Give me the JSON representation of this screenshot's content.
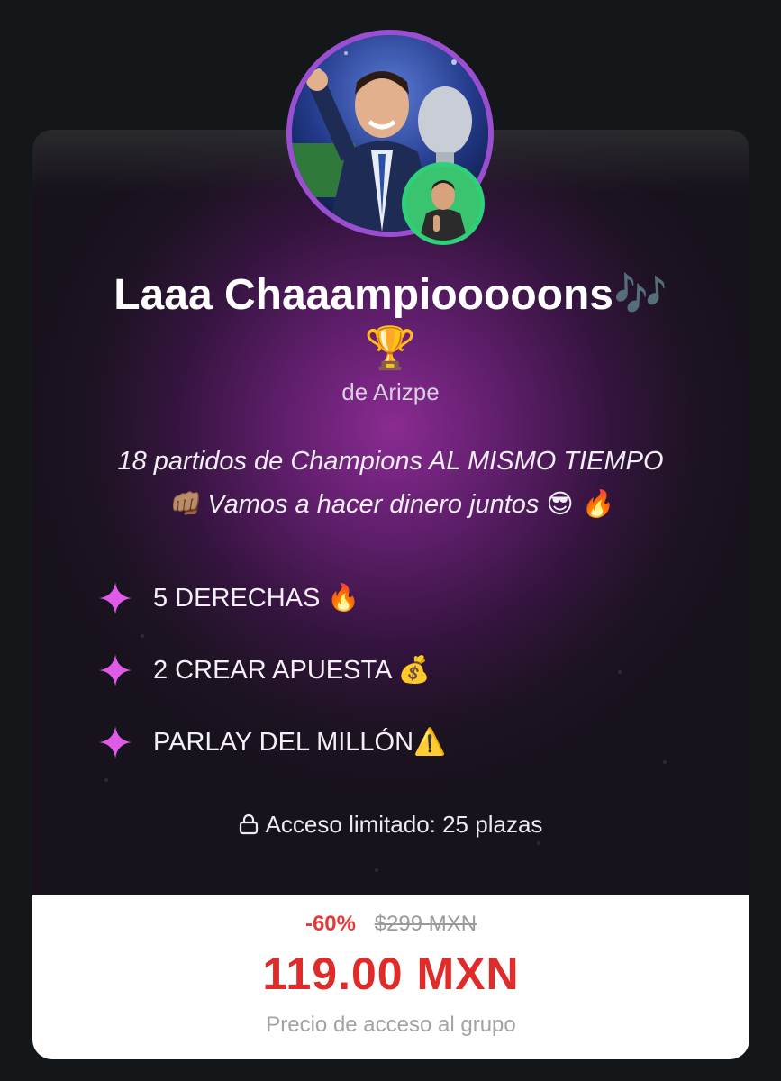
{
  "group": {
    "title": "Laaa Chaaampiooooons",
    "title_emoji": "🎶",
    "trophy_emoji": "🏆",
    "author": "de Arizpe",
    "description_line1": "18 partidos de Champions AL MISMO TIEMPO",
    "description_line2": "👊🏽 Vamos a hacer dinero juntos 😎 🔥"
  },
  "features": [
    {
      "label": "5 DERECHAS 🔥"
    },
    {
      "label": "2 CREAR APUESTA 💰"
    },
    {
      "label": "PARLAY DEL MILLÓN⚠️"
    }
  ],
  "access": {
    "text": "Acceso limitado: 25 plazas",
    "icon": "lock-icon"
  },
  "pricing": {
    "discount": "-60%",
    "original_price": "$299 MXN",
    "price": "119.00 MXN",
    "caption": "Precio de acceso al grupo"
  },
  "colors": {
    "accent": "#e02b2b",
    "sparkle": "#e05ce8",
    "ring": "#9a4fd0",
    "badge_ring": "#2fd07a"
  }
}
